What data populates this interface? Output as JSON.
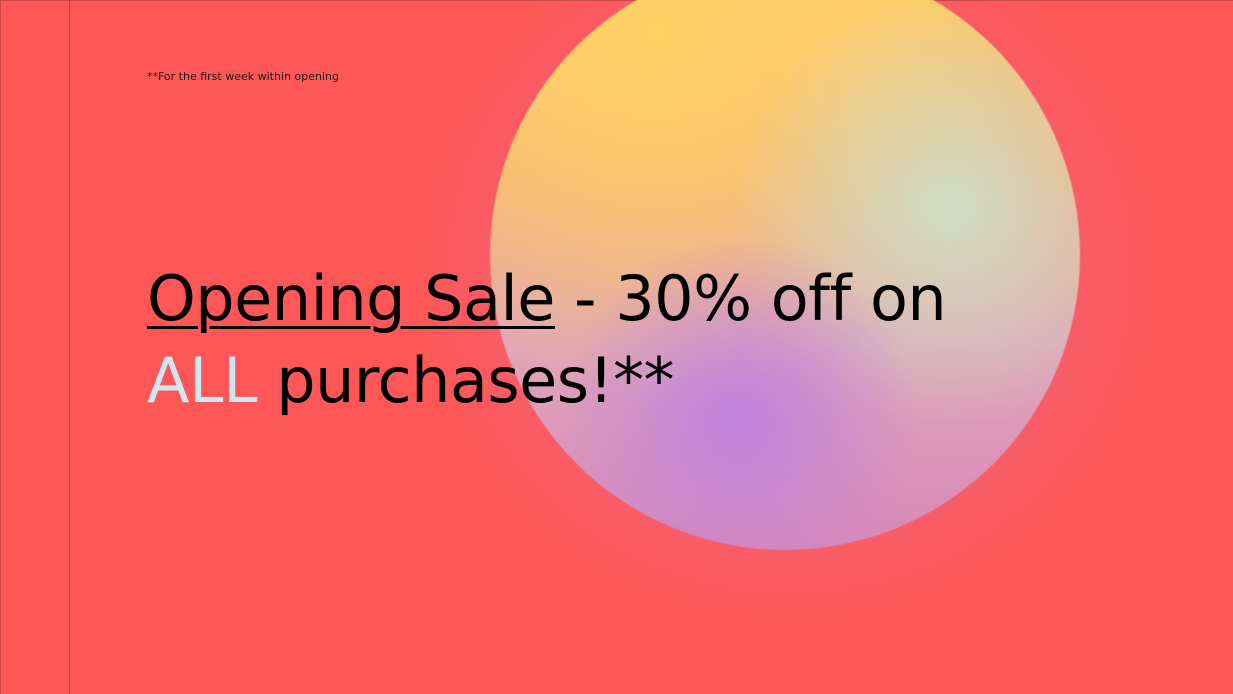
{
  "footnote": "**For the first week within opening",
  "headline": {
    "underlined": "Opening Sale",
    "rest_line1": " - 30% off on",
    "accent": "ALL",
    "rest_line2": " purchases!**"
  },
  "colors": {
    "background": "#ff5757",
    "accent_text": "#cde8f2",
    "text": "#000000"
  }
}
